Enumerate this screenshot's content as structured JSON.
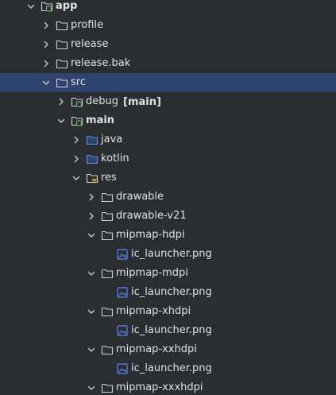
{
  "rows": [
    {
      "label": "app",
      "tag": "",
      "icon": "module-folder-icon",
      "chevron": "expanded",
      "depth": 0,
      "bold": true,
      "selected": false
    },
    {
      "label": "profile",
      "tag": "",
      "icon": "folder-icon",
      "chevron": "collapsed",
      "depth": 1,
      "bold": false,
      "selected": false
    },
    {
      "label": "release",
      "tag": "",
      "icon": "folder-icon",
      "chevron": "collapsed",
      "depth": 1,
      "bold": false,
      "selected": false
    },
    {
      "label": "release.bak",
      "tag": "",
      "icon": "folder-icon",
      "chevron": "collapsed",
      "depth": 1,
      "bold": false,
      "selected": false
    },
    {
      "label": "src",
      "tag": "",
      "icon": "folder-icon",
      "chevron": "expanded",
      "depth": 1,
      "bold": false,
      "selected": true
    },
    {
      "label": "debug",
      "tag": "[main]",
      "icon": "source-set-icon",
      "chevron": "collapsed",
      "depth": 2,
      "bold": false,
      "selected": false
    },
    {
      "label": "main",
      "tag": "",
      "icon": "source-set-icon",
      "chevron": "expanded",
      "depth": 2,
      "bold": true,
      "selected": false
    },
    {
      "label": "java",
      "tag": "",
      "icon": "source-root-icon",
      "chevron": "collapsed",
      "depth": 3,
      "bold": false,
      "selected": false
    },
    {
      "label": "kotlin",
      "tag": "",
      "icon": "source-root-icon",
      "chevron": "collapsed",
      "depth": 3,
      "bold": false,
      "selected": false
    },
    {
      "label": "res",
      "tag": "",
      "icon": "resource-folder-icon",
      "chevron": "expanded",
      "depth": 3,
      "bold": false,
      "selected": false
    },
    {
      "label": "drawable",
      "tag": "",
      "icon": "folder-icon",
      "chevron": "collapsed",
      "depth": 4,
      "bold": false,
      "selected": false
    },
    {
      "label": "drawable-v21",
      "tag": "",
      "icon": "folder-icon",
      "chevron": "collapsed",
      "depth": 4,
      "bold": false,
      "selected": false
    },
    {
      "label": "mipmap-hdpi",
      "tag": "",
      "icon": "folder-icon",
      "chevron": "expanded",
      "depth": 4,
      "bold": false,
      "selected": false
    },
    {
      "label": "ic_launcher.png",
      "tag": "",
      "icon": "image-file-icon",
      "chevron": "none",
      "depth": 5,
      "bold": false,
      "selected": false
    },
    {
      "label": "mipmap-mdpi",
      "tag": "",
      "icon": "folder-icon",
      "chevron": "expanded",
      "depth": 4,
      "bold": false,
      "selected": false
    },
    {
      "label": "ic_launcher.png",
      "tag": "",
      "icon": "image-file-icon",
      "chevron": "none",
      "depth": 5,
      "bold": false,
      "selected": false
    },
    {
      "label": "mipmap-xhdpi",
      "tag": "",
      "icon": "folder-icon",
      "chevron": "expanded",
      "depth": 4,
      "bold": false,
      "selected": false
    },
    {
      "label": "ic_launcher.png",
      "tag": "",
      "icon": "image-file-icon",
      "chevron": "none",
      "depth": 5,
      "bold": false,
      "selected": false
    },
    {
      "label": "mipmap-xxhdpi",
      "tag": "",
      "icon": "folder-icon",
      "chevron": "expanded",
      "depth": 4,
      "bold": false,
      "selected": false
    },
    {
      "label": "ic_launcher.png",
      "tag": "",
      "icon": "image-file-icon",
      "chevron": "none",
      "depth": 5,
      "bold": false,
      "selected": false
    },
    {
      "label": "mipmap-xxxhdpi",
      "tag": "",
      "icon": "folder-icon",
      "chevron": "expanded",
      "depth": 4,
      "bold": false,
      "selected": false
    }
  ],
  "colors": {
    "background": "#2b2d30",
    "selection": "#2e436e",
    "text": "#dfe1e5",
    "icon_stroke": "#ced0d6",
    "source_set_accent": "#5fb865",
    "source_root_accent": "#548af7",
    "resource_accent": "#d6ae58"
  }
}
